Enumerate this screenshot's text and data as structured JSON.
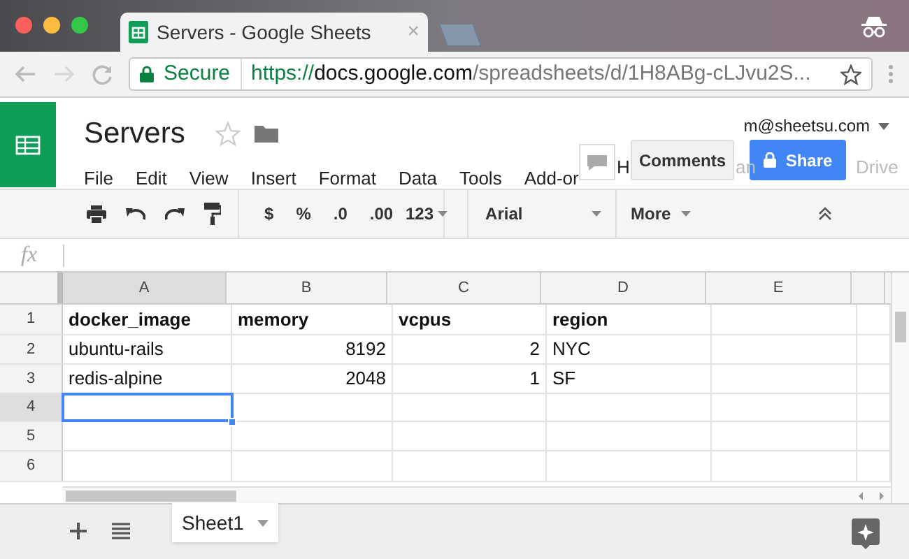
{
  "browser": {
    "tab_title": "Servers - Google Sheets",
    "tab_close": "×",
    "url": {
      "secure_label": "Secure",
      "scheme": "https://",
      "host": "docs.google.com",
      "path": "/spreadsheets/d/1H8ABg-cLJvu2S..."
    }
  },
  "document": {
    "title": "Servers",
    "account": "m@sheetsu.com",
    "menu": [
      {
        "label": "File",
        "faded": false
      },
      {
        "label": "Edit",
        "faded": false
      },
      {
        "label": "View",
        "faded": false
      },
      {
        "label": "Insert",
        "faded": false
      },
      {
        "label": "Format",
        "faded": false
      },
      {
        "label": "Data",
        "faded": false
      },
      {
        "label": "Tools",
        "faded": false
      },
      {
        "label": "Add-or",
        "faded": false
      }
    ],
    "menu_tail": [
      {
        "label": "H",
        "faded": false
      },
      {
        "label": "an",
        "faded": true
      },
      {
        "label": "Drive",
        "faded": true
      }
    ],
    "comments_button": "Comments",
    "share_button": "Share"
  },
  "toolbar": {
    "currency": "$",
    "percent": "%",
    "decrease_decimals": ".0",
    "increase_decimals": ".00",
    "number_format": "123",
    "font": "Arial",
    "more": "More"
  },
  "formula_bar": {
    "fx": "fx"
  },
  "grid": {
    "columns": [
      {
        "label": "A",
        "selected": true
      },
      {
        "label": "B",
        "selected": false
      },
      {
        "label": "C",
        "selected": false
      },
      {
        "label": "D",
        "selected": false
      },
      {
        "label": "E",
        "selected": false
      }
    ],
    "rows": [
      {
        "number": "1",
        "selected": false,
        "bold": true,
        "cells": [
          {
            "text": "docker_image",
            "kind": "text"
          },
          {
            "text": "memory",
            "kind": "text"
          },
          {
            "text": "vcpus",
            "kind": "text"
          },
          {
            "text": "region",
            "kind": "text"
          }
        ]
      },
      {
        "number": "2",
        "selected": false,
        "bold": false,
        "cells": [
          {
            "text": "ubuntu-rails",
            "kind": "text"
          },
          {
            "text": "8192",
            "kind": "number"
          },
          {
            "text": "2",
            "kind": "number"
          },
          {
            "text": "NYC",
            "kind": "text"
          }
        ]
      },
      {
        "number": "3",
        "selected": false,
        "bold": false,
        "cells": [
          {
            "text": "redis-alpine",
            "kind": "text"
          },
          {
            "text": "2048",
            "kind": "number"
          },
          {
            "text": "1",
            "kind": "number"
          },
          {
            "text": "SF",
            "kind": "text"
          }
        ]
      },
      {
        "number": "4",
        "selected": true
      },
      {
        "number": "5",
        "selected": false
      },
      {
        "number": "6",
        "selected": false
      }
    ]
  },
  "sheets": [
    {
      "label": "Sheet1",
      "selected": true
    }
  ]
}
